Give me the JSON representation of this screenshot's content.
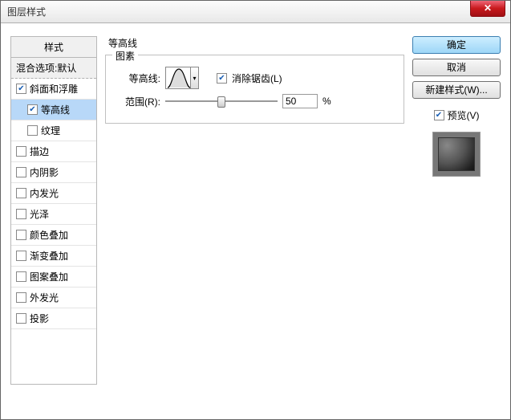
{
  "window": {
    "title": "图层样式"
  },
  "sidebar": {
    "header": "样式",
    "blend": "混合选项:默认",
    "items": [
      {
        "label": "斜面和浮雕",
        "checked": true,
        "selected": false,
        "indent": 0
      },
      {
        "label": "等高线",
        "checked": true,
        "selected": true,
        "indent": 1
      },
      {
        "label": "纹理",
        "checked": false,
        "selected": false,
        "indent": 1
      },
      {
        "label": "描边",
        "checked": false,
        "selected": false,
        "indent": 0
      },
      {
        "label": "内阴影",
        "checked": false,
        "selected": false,
        "indent": 0
      },
      {
        "label": "内发光",
        "checked": false,
        "selected": false,
        "indent": 0
      },
      {
        "label": "光泽",
        "checked": false,
        "selected": false,
        "indent": 0
      },
      {
        "label": "颜色叠加",
        "checked": false,
        "selected": false,
        "indent": 0
      },
      {
        "label": "渐变叠加",
        "checked": false,
        "selected": false,
        "indent": 0
      },
      {
        "label": "图案叠加",
        "checked": false,
        "selected": false,
        "indent": 0
      },
      {
        "label": "外发光",
        "checked": false,
        "selected": false,
        "indent": 0
      },
      {
        "label": "投影",
        "checked": false,
        "selected": false,
        "indent": 0
      }
    ]
  },
  "panel": {
    "title": "等高线",
    "group": "图素",
    "contour_label": "等高线:",
    "antialias_label": "消除锯齿(L)",
    "antialias_checked": true,
    "range_label": "范围(R):",
    "range_value": "50",
    "range_suffix": "%"
  },
  "buttons": {
    "ok": "确定",
    "cancel": "取消",
    "newstyle": "新建样式(W)...",
    "preview": "预览(V)",
    "preview_checked": true
  }
}
